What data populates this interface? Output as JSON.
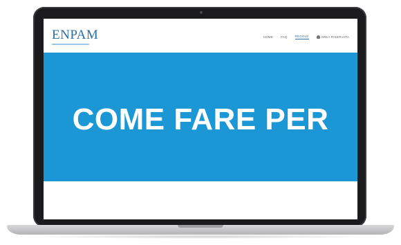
{
  "site": {
    "logo": "ENPAM",
    "nav": [
      {
        "label": "HOME",
        "active": false
      },
      {
        "label": "FAQ",
        "active": false
      },
      {
        "label": "REGOLE",
        "active": true
      },
      {
        "label": "AREA RISERVATA",
        "active": false,
        "icon": "user-icon"
      }
    ]
  },
  "banner": {
    "title": "COME FARE PER",
    "color": "#1c97d6"
  }
}
